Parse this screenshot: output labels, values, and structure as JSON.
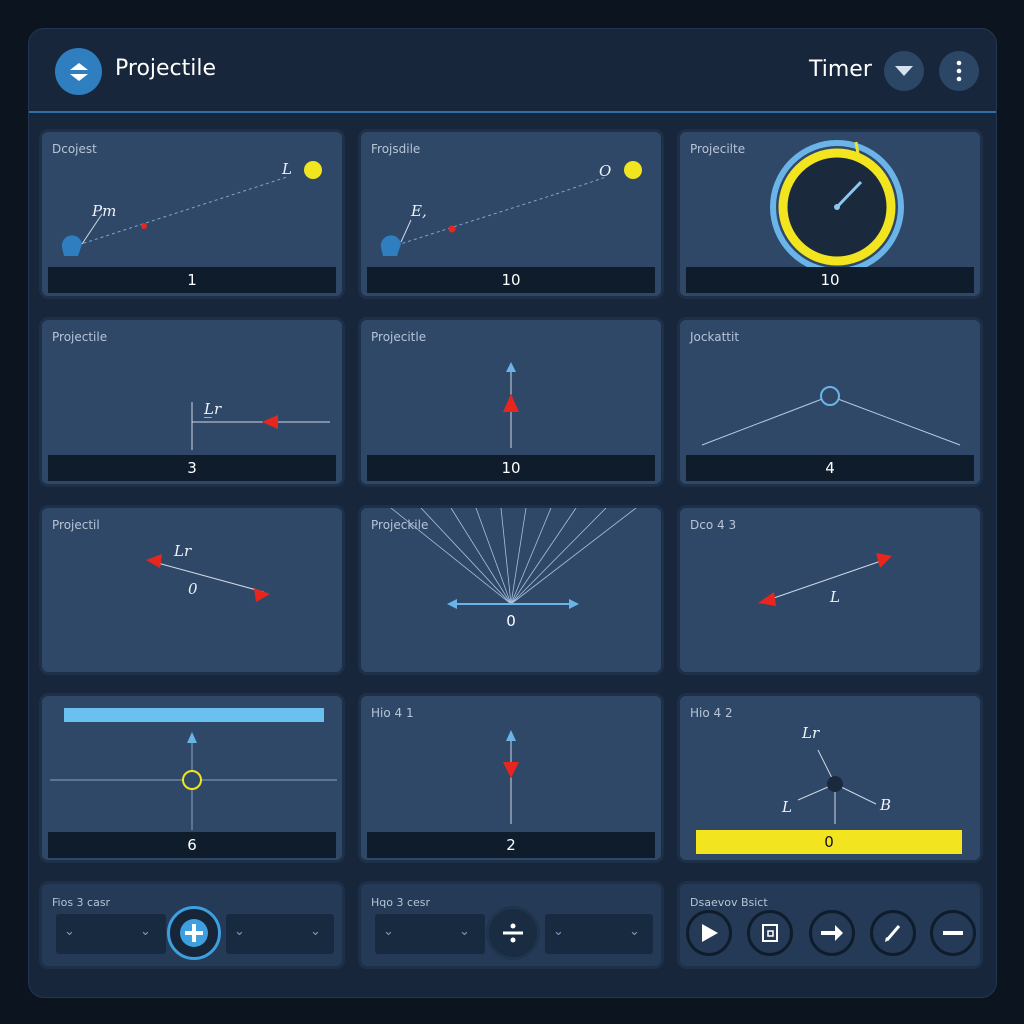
{
  "header": {
    "title": "Projectile",
    "timer_label": "Timer"
  },
  "panels": [
    {
      "title": "Dcojest",
      "value": "1",
      "labels": {
        "a": "Pm",
        "b": "L"
      }
    },
    {
      "title": "Frojsdile",
      "value": "10",
      "labels": {
        "a": "E,",
        "b": "O"
      }
    },
    {
      "title": "Projecilte",
      "value": "10"
    },
    {
      "title": "Projectile",
      "value": "3",
      "labels": {
        "a": "L̲r"
      }
    },
    {
      "title": "Projecitle",
      "value": "10"
    },
    {
      "title": "Jockattit",
      "value": "4"
    },
    {
      "title": "Projectil",
      "value": "0",
      "labels": {
        "a": "Lr"
      }
    },
    {
      "title": "Projeckile",
      "value": "0"
    },
    {
      "title": "Dco 4 3",
      "value": "",
      "labels": {
        "a": "L"
      }
    },
    {
      "title": "",
      "value": "6"
    },
    {
      "title": "Hio 4 1",
      "value": "2"
    },
    {
      "title": "Hio 4 2",
      "value": "0",
      "labels": {
        "a": "Lr",
        "b": "L",
        "c": "B"
      }
    }
  ],
  "controls": [
    {
      "title": "Fios 3 casr"
    },
    {
      "title": "Hqo 3 cesr"
    },
    {
      "title": "Dsaevov Bsict"
    }
  ],
  "colors": {
    "accent": "#3d9fe0",
    "yellow": "#f2e41e",
    "red": "#e8261e",
    "panel": "#2f4868"
  }
}
